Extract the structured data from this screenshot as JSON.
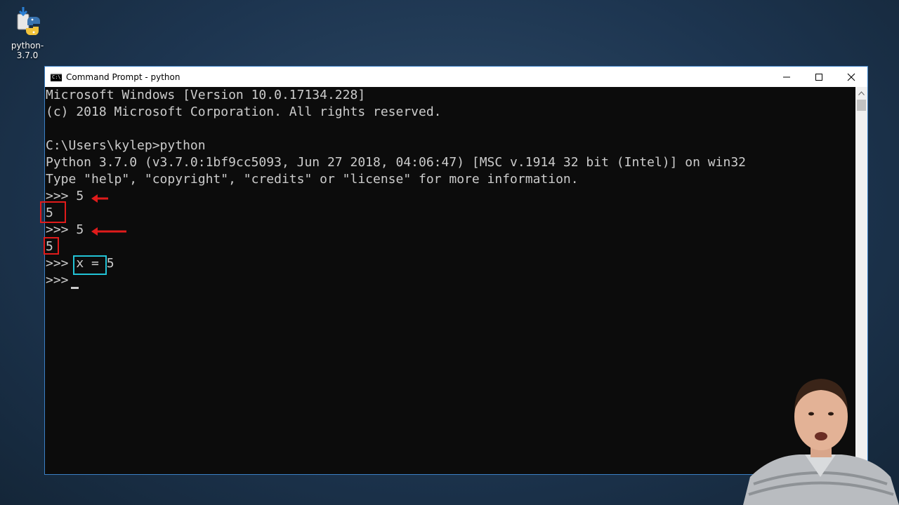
{
  "desktop": {
    "icon_label": "python-3.7.0",
    "icon_name": "python-installer-icon"
  },
  "window": {
    "title": "Command Prompt - python",
    "border_color": "#3a7fc4",
    "controls": [
      "minimize",
      "maximize",
      "close"
    ]
  },
  "console": {
    "lines": [
      "Microsoft Windows [Version 10.0.17134.228]",
      "(c) 2018 Microsoft Corporation. All rights reserved.",
      "",
      "C:\\Users\\kylep>python",
      "Python 3.7.0 (v3.7.0:1bf9cc5093, Jun 27 2018, 04:06:47) [MSC v.1914 32 bit (Intel)] on win32",
      "Type \"help\", \"copyright\", \"credits\" or \"license\" for more information.",
      ">>> 5",
      "5",
      ">>> 5",
      "5",
      ">>> x = 5",
      ">>> "
    ],
    "text_color": "#cccccc",
    "background": "#0c0c0c"
  },
  "annotations": {
    "red_color": "#e01b1b",
    "cyan_color": "#22c3d6"
  }
}
